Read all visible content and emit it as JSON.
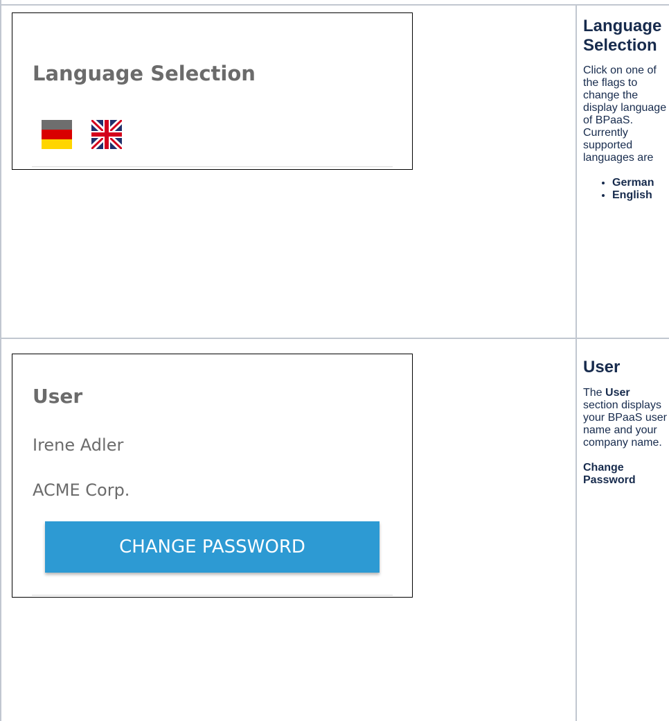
{
  "row1": {
    "screenshot": {
      "heading": "Language Selection",
      "flags": [
        {
          "name": "German",
          "icon": "german-flag-icon"
        },
        {
          "name": "English",
          "icon": "uk-flag-icon"
        }
      ]
    },
    "side": {
      "title": "Language Selection",
      "description": "Click on one of the flags to change the display language of BPaaS. Currently supported languages are",
      "languages": [
        "German",
        "English"
      ]
    }
  },
  "row2": {
    "screenshot": {
      "heading": "User",
      "user_name": "Irene Adler",
      "company": "ACME Corp.",
      "button": "CHANGE PASSWORD"
    },
    "side": {
      "title": "User",
      "text_before": "The ",
      "text_bold": "User",
      "text_after": " section displays your BPaaS user name and your company name.",
      "change_password_title": "Change Password"
    }
  },
  "colors": {
    "button_blue": "#2d9ad3",
    "heading_gray": "#6b6b6b",
    "table_border": "#c1c7d0"
  }
}
